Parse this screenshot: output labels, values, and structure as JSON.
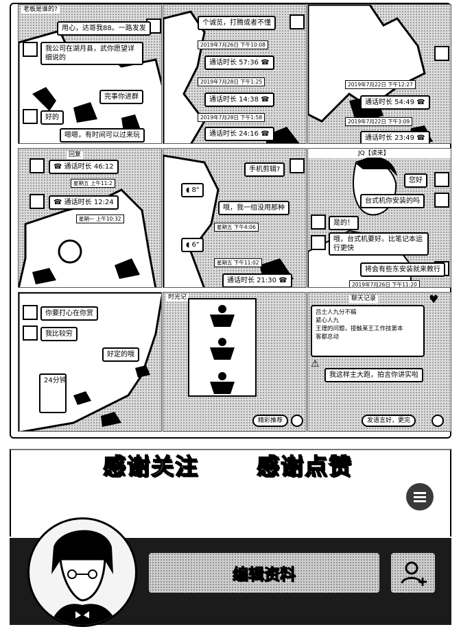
{
  "tiles": {
    "t1": {
      "header": "老板是谁的?",
      "bubbles": [
        "用心，达哥我88。一路发发",
        "我公司在湖月县，武你愿望详细说的",
        "完事你进群",
        "好的",
        "嗯嗯，有时间可以过来玩"
      ]
    },
    "t2": {
      "bubbles": [
        "个诚览，打腾或者不懂"
      ],
      "rows": [
        {
          "time": "2019年7月26日 下午10:08",
          "call": "通话时长 57:36"
        },
        {
          "time": "2019年7月28日 下午1:25",
          "call": "通话时长 14:38"
        },
        {
          "time": "2019年7月28日 下午1:58",
          "call": "通话时长 24:16"
        }
      ]
    },
    "t3": {
      "rows": [
        {
          "time": "2019年7月22日 下午12:27",
          "call": "通话时长 54:49"
        },
        {
          "time": "2019年7月22日 下午3:09",
          "call": "通话时长 23:49"
        }
      ]
    },
    "t4": {
      "header": "回复",
      "rows": [
        {
          "call": "通话时长 46:12",
          "time": "星期五 上午11:2"
        },
        {
          "call": "通话时长 12:24",
          "time": "星期一 上午10:32"
        }
      ]
    },
    "t5": {
      "bubbles": [
        "手机剪辑?",
        "哦，我一组没用那种"
      ],
      "times": [
        "星期五 下午4:06",
        "星期五 下午11:02"
      ],
      "call": "通话时长 21:30",
      "voices": [
        "8\"",
        "6\""
      ]
    },
    "t6": {
      "header": "JQ【读来】",
      "bubbles": [
        "您好",
        "台式机你安装的吗",
        "是的！",
        "哦，台式机要好。比笔记本运行更快",
        "将会有些东安装就来教行"
      ],
      "time": "2019年7月26日 下午11:20"
    },
    "t7": {
      "bubbles": [
        "你要打心在你赏",
        "我比较穷",
        "好定的哦"
      ],
      "time": "24分钟"
    },
    "t8": {
      "header": "时光记",
      "pill": "精彩推荐"
    },
    "t9": {
      "header": "聊天记录",
      "lines": [
        "吕士人九分不稿",
        "紧心人九",
        "王理的问题，接触某王工作技第本",
        "客都总动"
      ],
      "bubble": "我这样主大跑，拍言你讲实啦",
      "pill": "发语言好，更完"
    }
  },
  "banner": {
    "left": "感谢关注",
    "right": "感谢点赞"
  },
  "profile": {
    "edit_label": "编辑资料"
  },
  "icons": {
    "menu": "menu-icon",
    "follow": "add-friend-icon",
    "phone": "phone-icon"
  }
}
